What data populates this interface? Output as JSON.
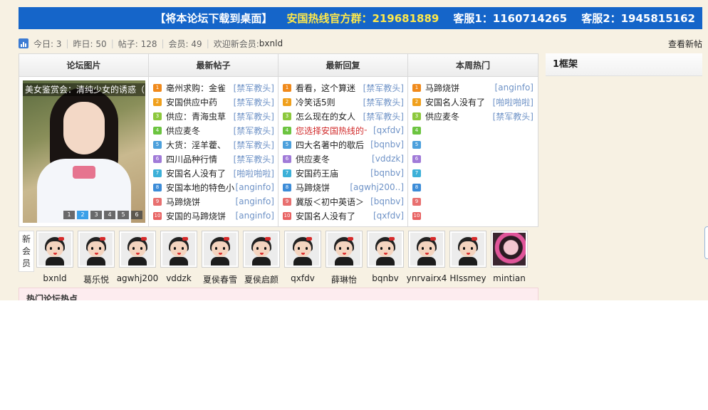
{
  "topbar": {
    "download": "【将本论坛下载到桌面】",
    "hotline_group": "安国热线官方群：219681889",
    "service1": "客服1：1160714265",
    "service2": "客服2：1945815162"
  },
  "stats": {
    "today": "今日: 3",
    "yesterday": "昨日: 50",
    "posts": "帖子: 128",
    "members": "会员: 49",
    "welcome": "欢迎新会员: ",
    "new_member": "bxnld",
    "view_new": "查看新帖"
  },
  "columns": {
    "pics": "论坛图片",
    "latest_posts": "最新帖子",
    "latest_replies": "最新回复",
    "weekly_hot": "本周热门"
  },
  "slideshow": {
    "caption": "美女鉴赏会：清纯少女的诱惑（",
    "pages": [
      "1",
      "2",
      "3",
      "4",
      "5",
      "6"
    ],
    "active_page": "2"
  },
  "latest_posts": [
    {
      "num": "1",
      "title": "亳州求购：金雀",
      "author": "[禁军教头]"
    },
    {
      "num": "2",
      "title": "安国供应中药",
      "author": "[禁军教头]"
    },
    {
      "num": "3",
      "title": "供应：青海虫草",
      "author": "[禁军教头]"
    },
    {
      "num": "4",
      "title": "供应麦冬",
      "author": "[禁军教头]"
    },
    {
      "num": "5",
      "title": "大货：淫羊藿、",
      "author": "[禁军教头]"
    },
    {
      "num": "6",
      "title": "四川品种行情",
      "author": "[禁军教头]"
    },
    {
      "num": "7",
      "title": "安国名人没有了",
      "author": "[啪啦啪啦]"
    },
    {
      "num": "8",
      "title": "安国本地的特色小",
      "author": "[anginfo]"
    },
    {
      "num": "9",
      "title": "马蹄烧饼",
      "author": "[anginfo]"
    },
    {
      "num": "10",
      "title": "安国的马蹄烧饼",
      "author": "[anginfo]"
    }
  ],
  "latest_replies": [
    {
      "num": "1",
      "title": "看看，这个算迷",
      "author": "[禁军教头]"
    },
    {
      "num": "2",
      "title": "冷笑话5则",
      "author": "[禁军教头]"
    },
    {
      "num": "3",
      "title": "怎么现在的女人",
      "author": "[禁军教头]"
    },
    {
      "num": "4",
      "title": "您选择安国热线的十",
      "author": "[qxfdv]",
      "red": true
    },
    {
      "num": "5",
      "title": "四大名著中的歇后",
      "author": "[bqnbv]"
    },
    {
      "num": "6",
      "title": "供应麦冬",
      "author": "[vddzk]"
    },
    {
      "num": "7",
      "title": "安国药王庙",
      "author": "[bqnbv]"
    },
    {
      "num": "8",
      "title": "马蹄烧饼",
      "author": "[agwhj200..]"
    },
    {
      "num": "9",
      "title": "冀版＜初中英语＞",
      "author": "[bqnbv]"
    },
    {
      "num": "10",
      "title": "安国名人没有了",
      "author": "[qxfdv]"
    }
  ],
  "weekly_hot": [
    {
      "num": "1",
      "title": "马蹄烧饼",
      "author": "[anginfo]"
    },
    {
      "num": "2",
      "title": "安国名人没有了",
      "author": "[啪啦啪啦]"
    },
    {
      "num": "3",
      "title": "供应麦冬",
      "author": "[禁军教头]"
    },
    {
      "num": "4",
      "title": "",
      "author": ""
    },
    {
      "num": "5",
      "title": "",
      "author": ""
    },
    {
      "num": "6",
      "title": "",
      "author": ""
    },
    {
      "num": "7",
      "title": "",
      "author": ""
    },
    {
      "num": "8",
      "title": "",
      "author": ""
    },
    {
      "num": "9",
      "title": "",
      "author": ""
    },
    {
      "num": "10",
      "title": "",
      "author": ""
    }
  ],
  "frame1_title": "1框架",
  "new_members_label": "新会员",
  "new_members": [
    "bxnld",
    "葛乐悦",
    "agwhj200",
    "vddzk",
    "夏侯春雪",
    "夏侯启颜",
    "qxfdv",
    "薛琳怡",
    "bqnbv",
    "ynrvairx4",
    "HIssmey",
    "mintian"
  ],
  "hot_topics_title": "热门论坛热点"
}
